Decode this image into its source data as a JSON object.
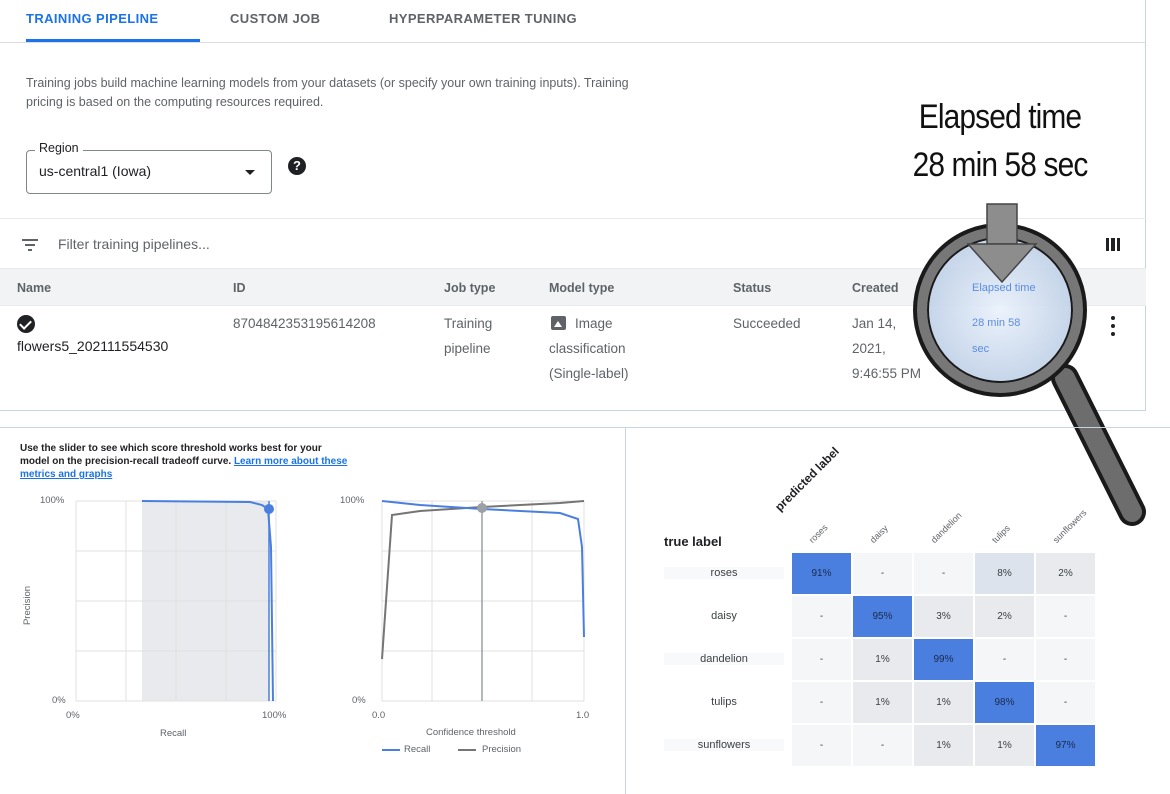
{
  "tabs": [
    "TRAINING PIPELINE",
    "CUSTOM JOB",
    "HYPERPARAMETER TUNING"
  ],
  "description": "Training jobs build machine learning models from your datasets (or specify your own training inputs). Training pricing is based on the computing resources required.",
  "region": {
    "label": "Region",
    "value": "us-central1 (Iowa)"
  },
  "filter_placeholder": "Filter training pipelines...",
  "table": {
    "headers": [
      "Name",
      "ID",
      "Job type",
      "Model type",
      "Status",
      "Created"
    ],
    "row": {
      "name": "flowers5_202111554530",
      "id": "8704842353195614208",
      "job_type_1": "Training",
      "job_type_2": "pipeline",
      "model_type_1": "Image",
      "model_type_2": "classification",
      "model_type_3": "(Single-label)",
      "status": "Succeeded",
      "created_1": "Jan 14,",
      "created_2": "2021,",
      "created_3": "9:46:55 PM"
    }
  },
  "callout": {
    "line1": "Elapsed time",
    "line2": "28 min 58 sec"
  },
  "lens": {
    "header": "Elapsed time",
    "value_1": "28 min 58",
    "value_2": "sec"
  },
  "pr_panel": {
    "text": "Use the slider to see which score threshold works best for your model on the precision-recall tradeoff curve.",
    "link": "Learn more about these metrics and graphs",
    "pr_chart": {
      "y_top": "100%",
      "y_bottom": "0%",
      "x_left": "0%",
      "x_right": "100%",
      "xlabel": "Recall",
      "ylabel": "Precision"
    },
    "threshold_chart": {
      "y_top": "100%",
      "y_bottom": "0%",
      "x_left": "0.0",
      "x_right": "1.0",
      "xlabel": "Confidence threshold",
      "legend_recall": "Recall",
      "legend_precision": "Precision"
    }
  },
  "confusion_matrix": {
    "title": "true label",
    "predicted": "predicted label",
    "labels": [
      "roses",
      "daisy",
      "dandelion",
      "tulips",
      "sunflowers"
    ],
    "rows": [
      [
        "91%",
        "-",
        "-",
        "8%",
        "2%"
      ],
      [
        "-",
        "95%",
        "3%",
        "2%",
        "-"
      ],
      [
        "-",
        "1%",
        "99%",
        "-",
        "-"
      ],
      [
        "-",
        "1%",
        "1%",
        "98%",
        "-"
      ],
      [
        "-",
        "-",
        "1%",
        "1%",
        "97%"
      ]
    ]
  },
  "colors": {
    "accent": "#1a73e8",
    "matrix_strong": "#4a7fe0",
    "matrix_light": "#e8eaed"
  }
}
